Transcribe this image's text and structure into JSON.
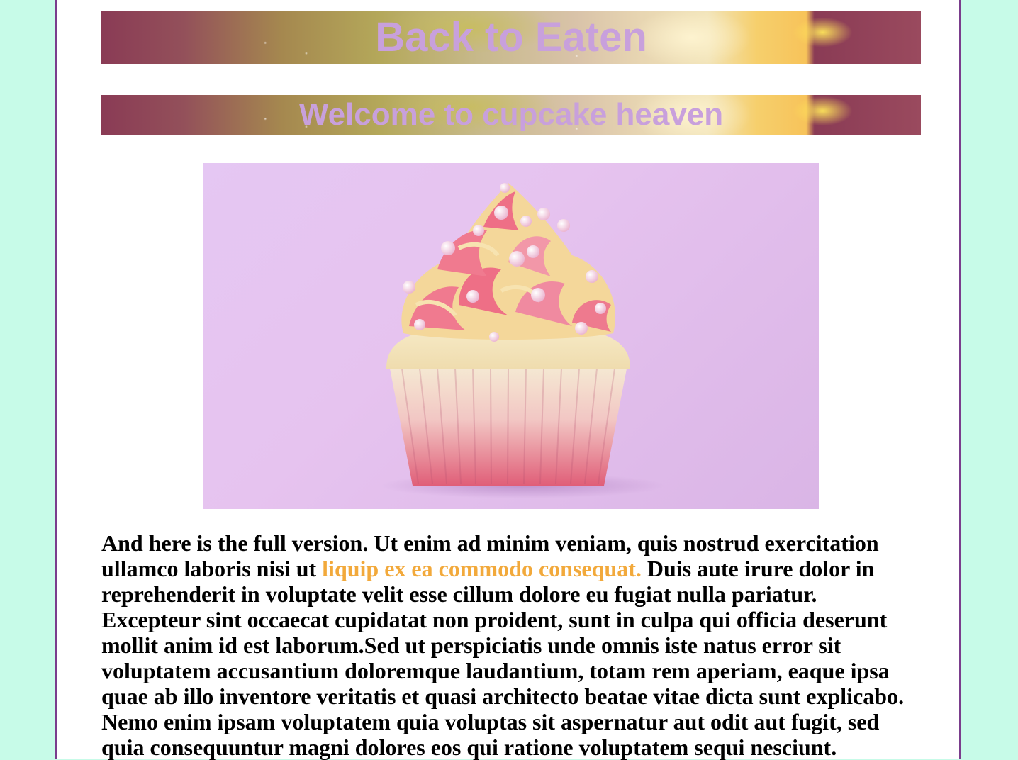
{
  "header": {
    "title": "Back to Eaten",
    "subtitle": "Welcome to cupcake heaven"
  },
  "hero_image": {
    "alt": "cupcake"
  },
  "content": {
    "text_before_link": "And here is the full version. Ut enim ad minim veniam, quis nostrud exercitation ullamco laboris nisi ut ",
    "link_text": "liquip ex ea commodo consequat.",
    "text_after_link": " Duis aute irure dolor in reprehenderit in voluptate velit esse cillum dolore eu fugiat nulla pariatur. Excepteur sint occaecat cupidatat non proident, sunt in culpa qui officia deserunt mollit anim id est laborum.Sed ut perspiciatis unde omnis iste natus error sit voluptatem accusantium doloremque laudantium, totam rem aperiam, eaque ipsa quae ab illo inventore veritatis et quasi architecto beatae vitae dicta sunt explicabo. Nemo enim ipsam voluptatem quia voluptas sit aspernatur aut odit aut fugit, sed quia consequuntur magni dolores eos qui ratione voluptatem sequi nesciunt."
  },
  "colors": {
    "page_background": "#c7fbe8",
    "border": "#7a3d8c",
    "banner_text": "#c8a0dc",
    "link": "#f2a93b"
  }
}
